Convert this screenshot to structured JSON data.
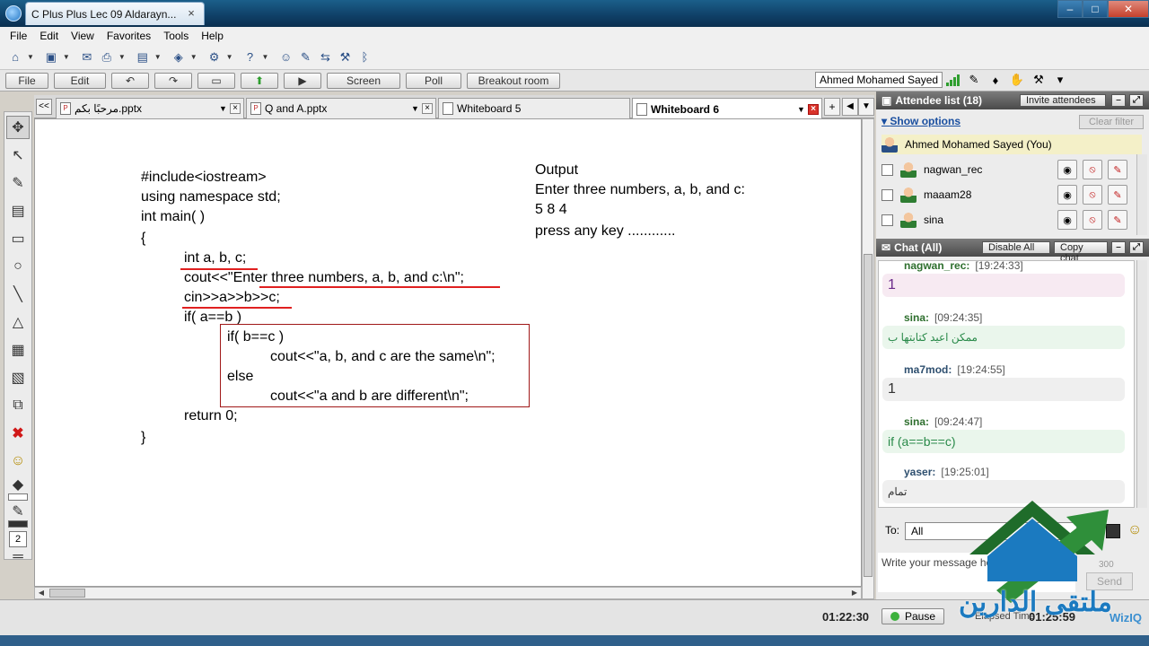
{
  "window": {
    "tab_title": "C Plus Plus Lec 09 Aldarayn...",
    "close": "×",
    "min": "–",
    "max": "□",
    "close_win": "✕"
  },
  "menu": [
    "File",
    "Edit",
    "View",
    "Favorites",
    "Tools",
    "Help"
  ],
  "wiz_toolbar": {
    "file": "File",
    "edit": "Edit",
    "screen": "Screen",
    "poll": "Poll",
    "breakout": "Breakout room",
    "user": "Ahmed Mohamed Sayed"
  },
  "doc_tabs": {
    "tab1": "مرحبًا بكم.pptx",
    "tab2": "Q and A.pptx",
    "tab3": "Whiteboard 5",
    "tab4": "Whiteboard 6",
    "add": "+",
    "prev": "<<"
  },
  "tools": {
    "size": "2"
  },
  "code": {
    "l1": "#include<iostream>",
    "l2": "using namespace std;",
    "l3": "int main( )",
    "l4": "{",
    "l5": "int a, b, c;",
    "l6": "cout<<\"Enter three numbers, a, b, and c:\\n\";",
    "l7": "cin>>a>>b>>c;",
    "l8": "if( a==b )",
    "l9": "if( b==c )",
    "l10": "cout<<\"a, b, and c are the same\\n\";",
    "l11": "else",
    "l12": "cout<<\"a and b are different\\n\";",
    "l13": "return 0;",
    "l14": "}"
  },
  "output": {
    "o1": "Output",
    "o2": "Enter three numbers, a, b, and c:",
    "o3": "5 8 4",
    "o4": "press any key ............"
  },
  "attendees": {
    "header": "Attendee list (18)",
    "invite": "Invite attendees",
    "show_options": "Show options",
    "clear_filter": "Clear filter",
    "self": "Ahmed Mohamed Sayed (You)",
    "list": [
      "nagwan_rec",
      "maaam28",
      "sina"
    ]
  },
  "chat": {
    "header": "Chat (All)",
    "disable_all": "Disable All",
    "copy_chat": "Copy chat",
    "messages": [
      {
        "sender": "nagwan_rec:",
        "time": "[19:24:33]",
        "text": "1"
      },
      {
        "sender": "sina:",
        "time": "[09:24:35]",
        "text": "ممكن اعيد كتابتها ب"
      },
      {
        "sender": "ma7mod:",
        "time": "[19:24:55]",
        "text": "1"
      },
      {
        "sender": "sina:",
        "time": "[09:24:47]",
        "text": "if (a==b==c)"
      },
      {
        "sender": "yaser:",
        "time": "[19:25:01]",
        "text": "تمام"
      }
    ],
    "to_label": "To:",
    "to_value": "All",
    "input_placeholder": "Write your message he",
    "char_count": "300",
    "send": "Send"
  },
  "status": {
    "timer": "01:22:30",
    "pause": "Pause",
    "elapsed_label": "Elapsed Time",
    "elapsed": "01:25:59",
    "brand": "WizIQ"
  },
  "watermark": {
    "text": "ملتقى الدارين"
  }
}
